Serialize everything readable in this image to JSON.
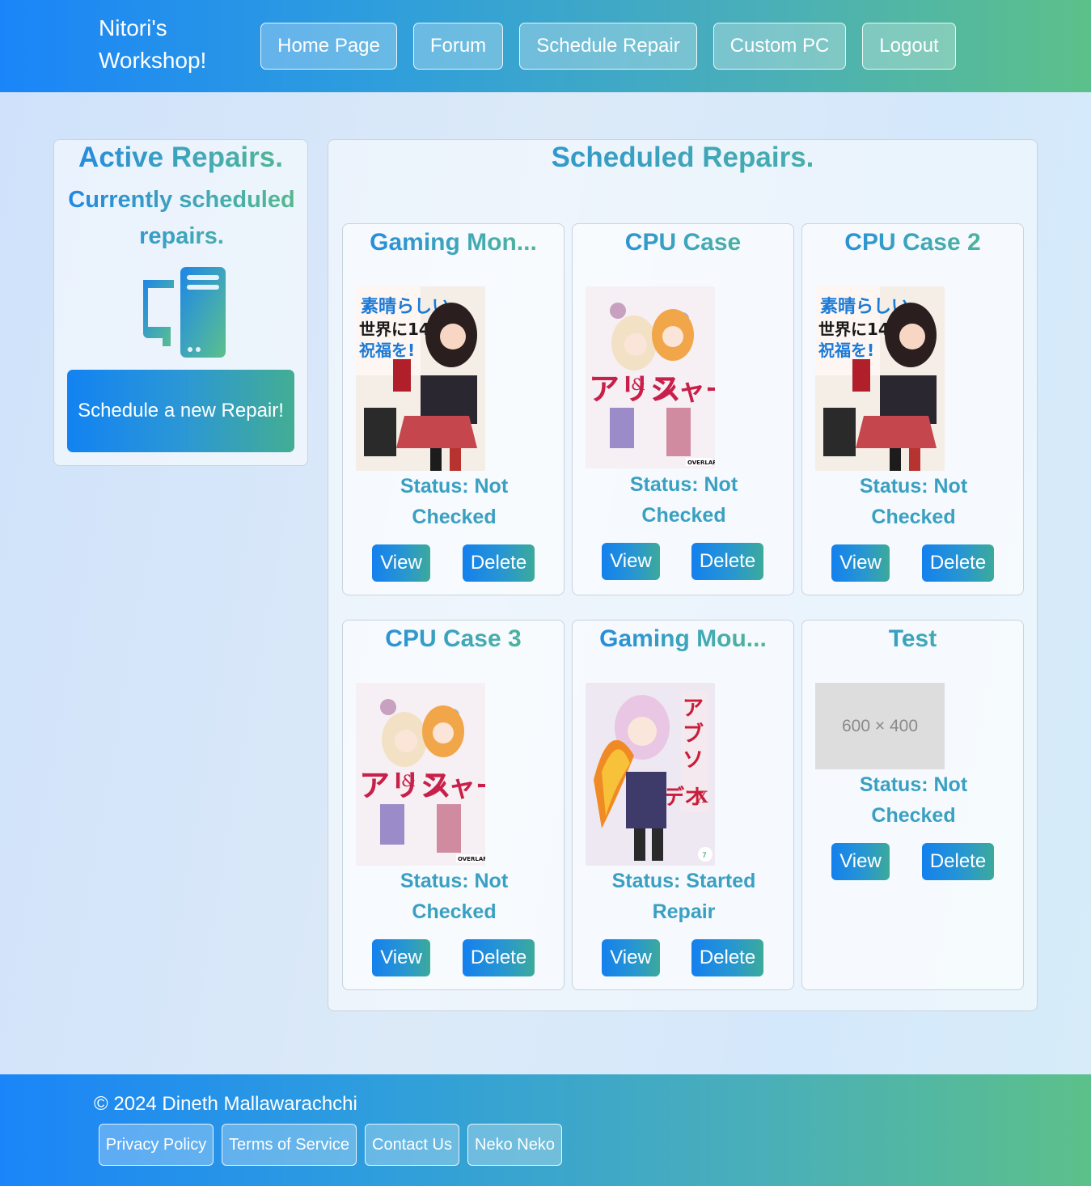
{
  "header": {
    "brand": "Nitori's Workshop!",
    "nav": [
      "Home Page",
      "Forum",
      "Schedule Repair",
      "Custom PC",
      "Logout"
    ]
  },
  "active_repairs": {
    "title": "Active Repairs.",
    "subtitle": "Currently scheduled repairs.",
    "icon": "computer-icon",
    "button": "Schedule a new Repair!"
  },
  "scheduled": {
    "title": "Scheduled Repairs.",
    "view_label": "View",
    "delete_label": "Delete",
    "items": [
      {
        "title": "Gaming Mon...",
        "status": "Status: Not Checked",
        "image": "light-novel-cover-red"
      },
      {
        "title": "CPU Case",
        "status": "Status: Not Checked",
        "image": "light-novel-cover-white"
      },
      {
        "title": "CPU Case 2",
        "status": "Status: Not Checked",
        "image": "light-novel-cover-red"
      },
      {
        "title": "CPU Case 3",
        "status": "Status: Not Checked",
        "image": "light-novel-cover-white"
      },
      {
        "title": "Gaming Mou...",
        "status": "Status: Started Repair",
        "image": "light-novel-cover-pink"
      },
      {
        "title": "Test",
        "status": "Status: Not Checked",
        "image": "placeholder",
        "placeholder_text": "600 × 400"
      }
    ]
  },
  "footer": {
    "copyright": "© 2024 Dineth Mallawarachchi",
    "links": [
      "Privacy Policy",
      "Terms of Service",
      "Contact Us",
      "Neko Neko"
    ]
  },
  "colors": {
    "brand_gradient_start": "#1a85f8",
    "brand_gradient_end": "#5cc08a",
    "accent_blue": "#1e86e6",
    "accent_teal": "#43aab3"
  }
}
